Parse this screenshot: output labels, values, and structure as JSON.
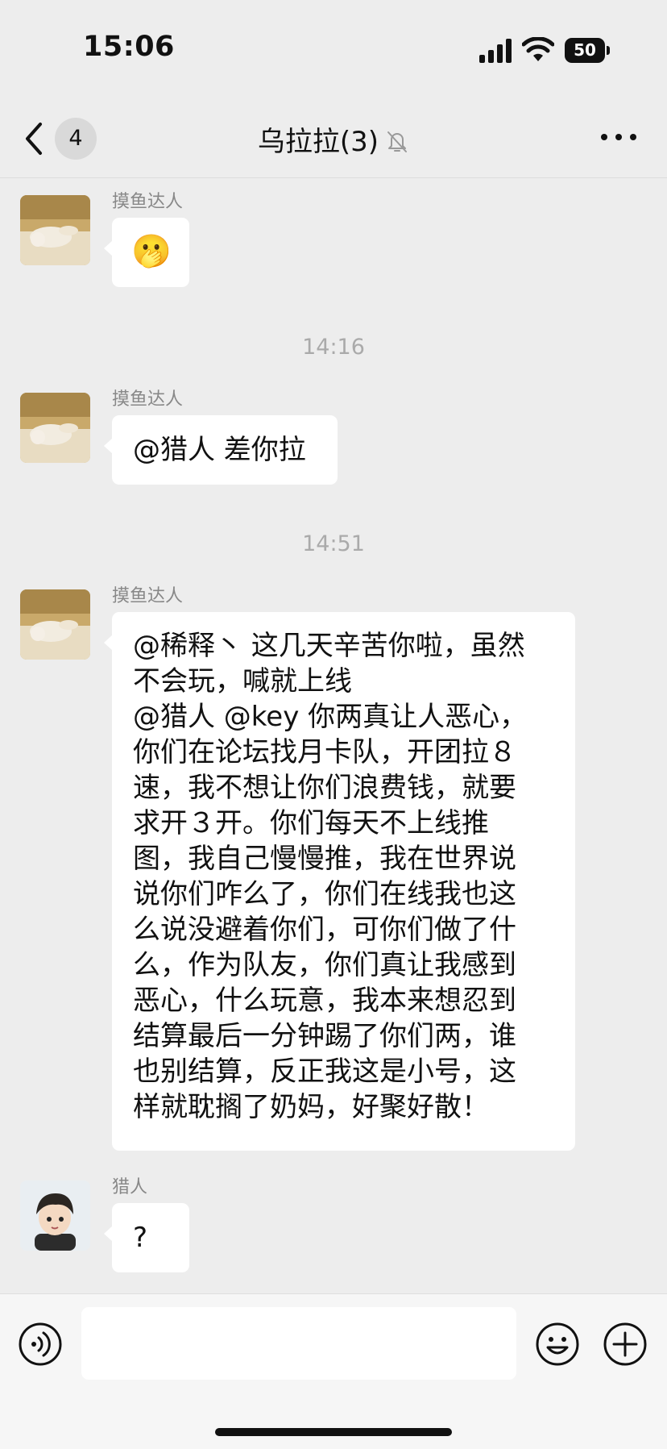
{
  "status_bar": {
    "time": "15:06",
    "battery": "50"
  },
  "nav": {
    "back_count": "4",
    "title": "乌拉拉(3)",
    "muted": true
  },
  "messages": [
    {
      "sender": "摸鱼达人",
      "text": "🫢"
    },
    {
      "divider": "14:16"
    },
    {
      "sender": "摸鱼达人",
      "text": "@猎人 差你拉"
    },
    {
      "divider": "14:51"
    },
    {
      "sender": "摸鱼达人",
      "lines": [
        "@稀释丶 这几天辛苦你啦，虽然",
        "不会玩，喊就上线",
        "@猎人 @key 你两真让人恶心，",
        "你们在论坛找月卡队，开团拉８",
        "速，我不想让你们浪费钱，就要",
        "求开３开。你们每天不上线推",
        "图，我自己慢慢推，我在世界说",
        "说你们咋么了，你们在线我也这",
        "么说没避着你们，可你们做了什",
        "么，作为队友，你们真让我感到",
        "恶心，什么玩意，我本来想忍到",
        "结算最后一分钟踢了你们两，谁",
        "也别结算，反正我这是小号，这",
        "样就耽搁了奶妈，好聚好散！"
      ]
    },
    {
      "sender": "猎人",
      "text": "?"
    }
  ],
  "input_bar": {
    "placeholder": ""
  },
  "icons": {
    "back": "chevron-left-icon",
    "mute": "bell-slash-icon",
    "more": "more-dots-icon",
    "voice": "voice-icon",
    "emoji": "emoji-icon",
    "plus": "plus-icon"
  }
}
